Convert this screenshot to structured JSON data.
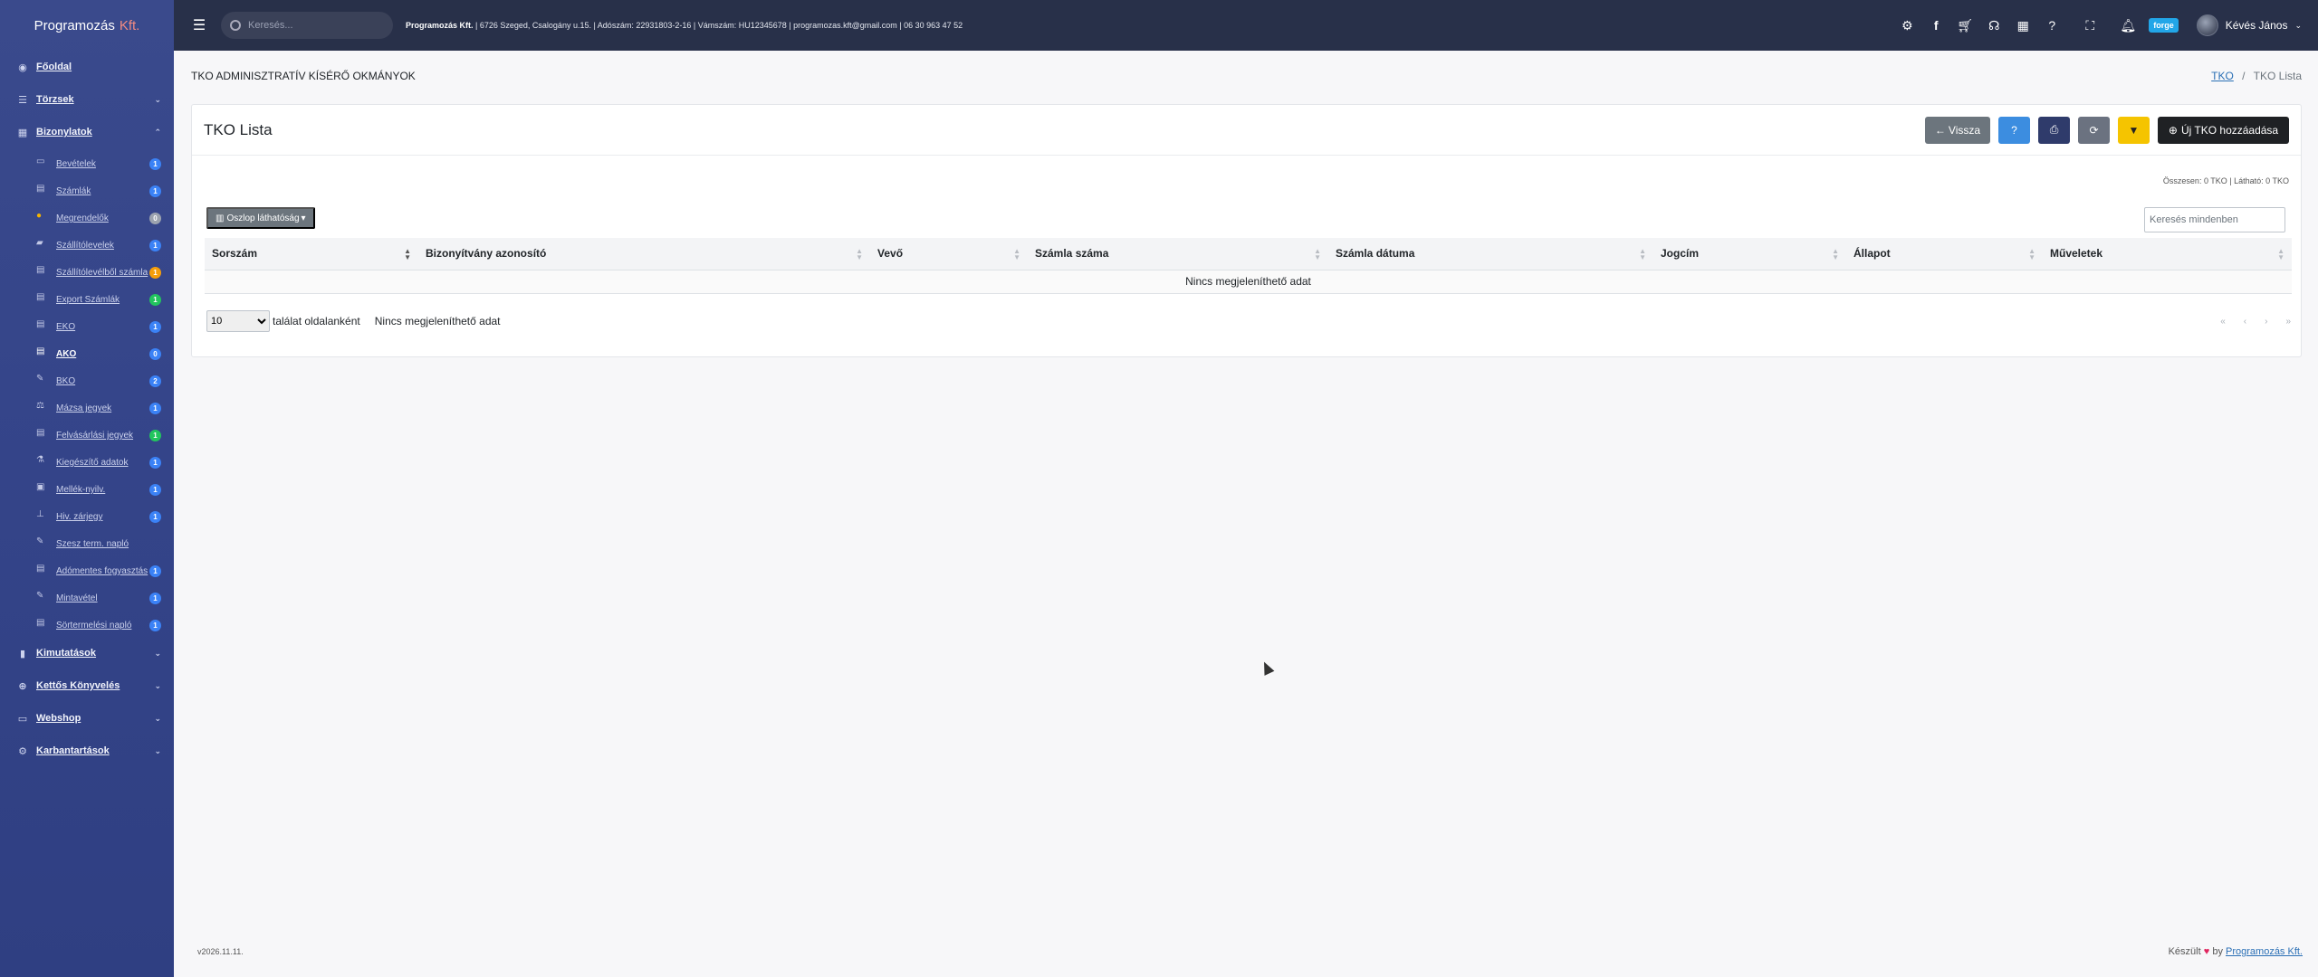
{
  "brand": {
    "name": "Programozás",
    "suffix": "Kft."
  },
  "topbar": {
    "search_placeholder": "Keresés...",
    "company_name": "Programozás Kft.",
    "company_details": "| 6726 Szeged, Csalogány u.15. | Adószám: 22931803-2-16 | Vámszám: HU12345678 | programozas.kft@gmail.com | 06 30 963 47 52",
    "forge_label": "forge",
    "user_name": "Kévés János"
  },
  "sidebar": {
    "main_items": [
      {
        "label": "Főoldal",
        "icon": "dashboard-icon"
      },
      {
        "label": "Törzsek",
        "icon": "list-icon"
      },
      {
        "label": "Bizonylatok",
        "icon": "table-icon"
      }
    ],
    "sub_items": [
      {
        "label": "Bevételek",
        "badge": "1"
      },
      {
        "label": "Számlák",
        "badge": "1"
      },
      {
        "label": "Megrendelők",
        "badge": "0"
      },
      {
        "label": "Szállítólevelek",
        "badge": "1"
      },
      {
        "label": "Szállítólevélből számla",
        "badge": "1"
      },
      {
        "label": "Export Számlák",
        "badge": "1"
      },
      {
        "label": "EKO",
        "badge": "1"
      },
      {
        "label": "AKO",
        "badge": "0"
      },
      {
        "label": "BKO",
        "badge": "2"
      },
      {
        "label": "Mázsa jegyek",
        "badge": "1"
      },
      {
        "label": "Felvásárlási jegyek",
        "badge": "1"
      },
      {
        "label": "Kiegészítő adatok",
        "badge": "1"
      },
      {
        "label": "Mellék-nyilv.",
        "badge": "1"
      },
      {
        "label": "Hiv. zárjegy",
        "badge": "1"
      },
      {
        "label": "Szesz term. napló",
        "badge": ""
      },
      {
        "label": "Adómentes fogyasztás",
        "badge": "1"
      },
      {
        "label": "Mintavétel",
        "badge": "1"
      },
      {
        "label": "Sörtermelési napló",
        "badge": "1"
      }
    ],
    "bottom_items": [
      {
        "label": "Kimutatások"
      },
      {
        "label": "Kettős Könyvelés"
      },
      {
        "label": "Webshop"
      },
      {
        "label": "Karbantartások"
      }
    ]
  },
  "page": {
    "title": "TKO ADMINISZTRATÍV KÍSÉRŐ OKMÁNYOK",
    "breadcrumb_link": "TKO",
    "breadcrumb_current": "TKO Lista"
  },
  "card": {
    "title": "TKO Lista",
    "back_label": "Vissza",
    "add_label": "Új TKO hozzáadása",
    "summary": "Összesen: 0 TKO | Látható: 0 TKO",
    "column_visibility": "Oszlop láthatóság",
    "search_placeholder": "Keresés mindenben",
    "columns": [
      "Sorszám",
      "Bizonyítvány azonosító",
      "Vevő",
      "Számla száma",
      "Számla dátuma",
      "Jogcím",
      "Állapot",
      "Műveletek"
    ],
    "empty_text": "Nincs megjeleníthető adat",
    "page_size": "10",
    "per_page_label": "találat oldalanként",
    "footer_empty": "Nincs megjeleníthető adat",
    "pager": [
      "«",
      "‹",
      "›",
      "»"
    ]
  },
  "footer": {
    "version": "v2026.11.11.",
    "made_prefix": "Készült",
    "made_by": "by",
    "made_link": "Programozás Kft."
  }
}
